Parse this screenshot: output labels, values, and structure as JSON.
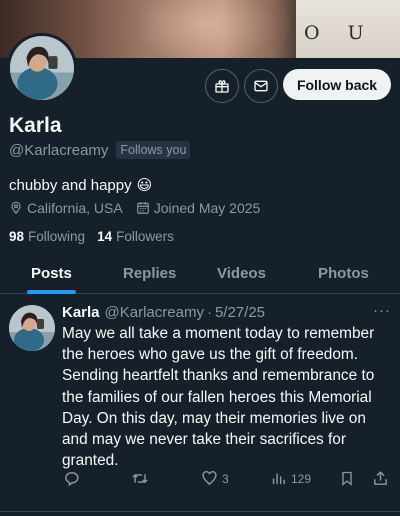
{
  "banner": {
    "paper_text": "O U"
  },
  "profile": {
    "name": "Karla",
    "handle": "@Karlacreamy",
    "follows_you": "Follows you",
    "bio": "chubby and happy",
    "bio_emoji": "😃",
    "location": "California, USA",
    "joined": "Joined May 2025",
    "following_count": "98",
    "following_label": "Following",
    "followers_count": "14",
    "followers_label": "Followers"
  },
  "actions": {
    "follow_back_label": "Follow back"
  },
  "tabs": [
    {
      "label": "Posts",
      "active": true
    },
    {
      "label": "Replies",
      "active": false
    },
    {
      "label": "Videos",
      "active": false
    },
    {
      "label": "Photos",
      "active": false
    }
  ],
  "tweet": {
    "author": "Karla",
    "handle": "@Karlacreamy",
    "separator": "·",
    "date": "5/27/25",
    "more": "···",
    "lines": [
      "May we all take a moment today to remember",
      "the heroes who gave us the gift of freedom.",
      "Sending heartfelt thanks and remembrance to",
      "the families of our fallen heroes this Memorial",
      "Day. On this day, may their memories live on",
      "and may we never take their sacrifices for",
      "granted."
    ],
    "likes": "3",
    "views": "129"
  },
  "colors": {
    "background": "#15202b",
    "accent": "#1d9bf0",
    "secondary_text": "#8b98a5",
    "primary_text": "#f7f9f9"
  },
  "icons": {
    "gift": "gift-icon",
    "message": "envelope-icon",
    "location": "map-pin-icon",
    "calendar": "calendar-icon",
    "reply": "reply-icon",
    "repost": "repost-icon",
    "like": "heart-icon",
    "views": "analytics-icon",
    "bookmark": "bookmark-icon",
    "share": "share-icon"
  }
}
